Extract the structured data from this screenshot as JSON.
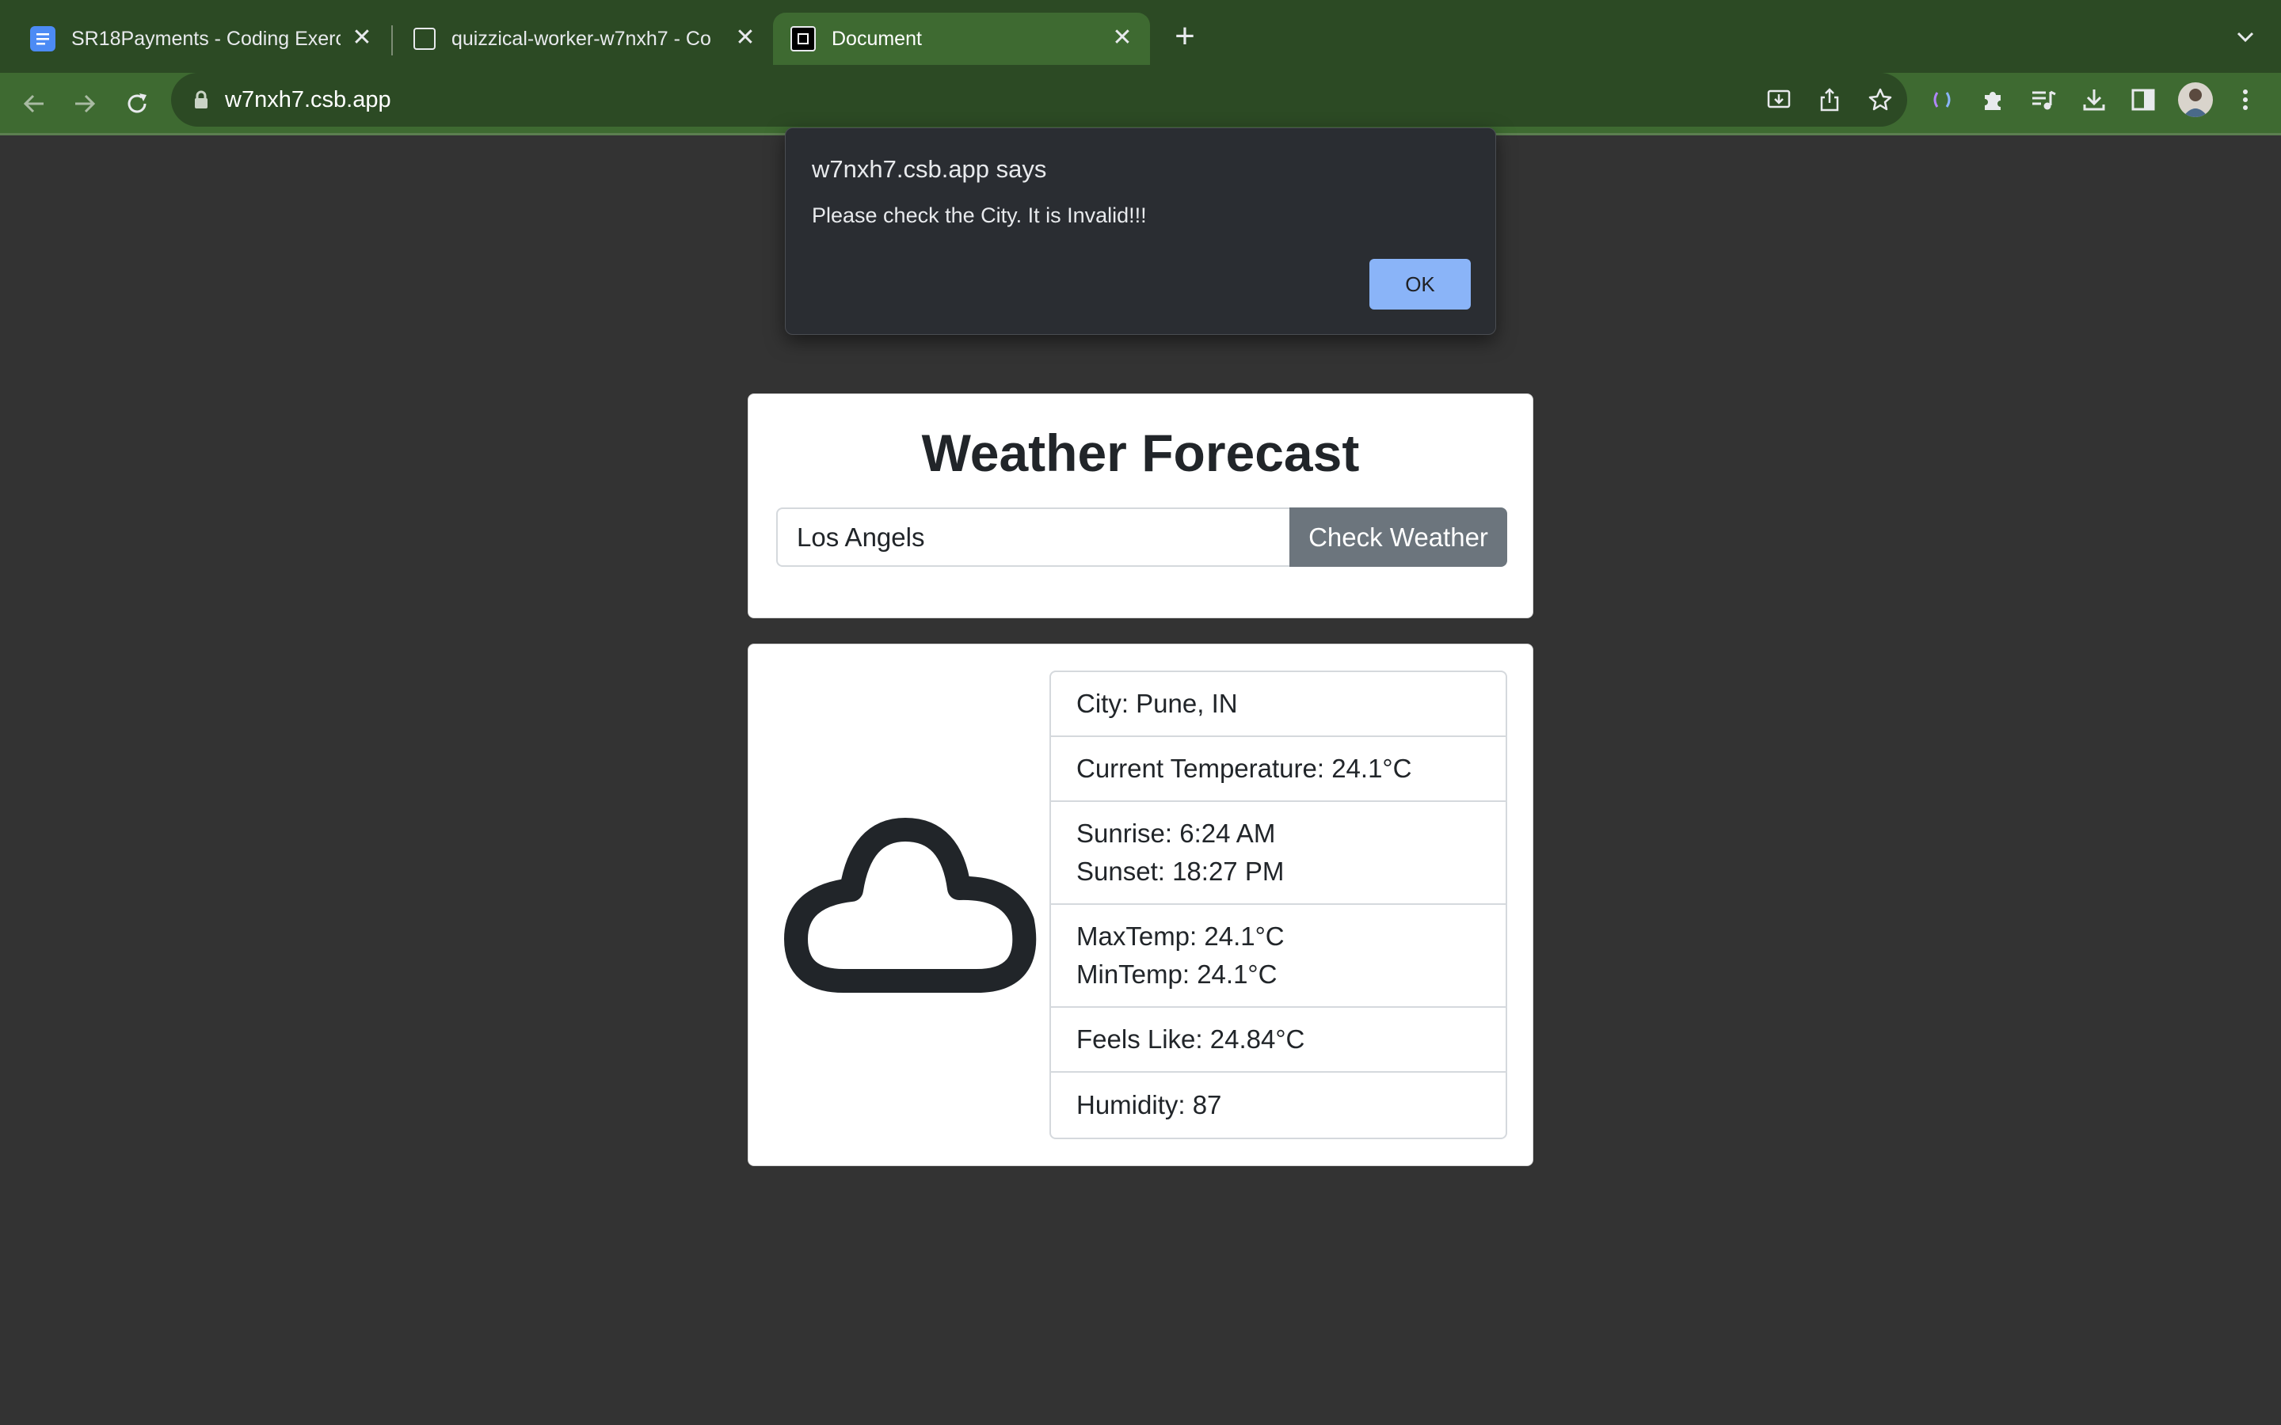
{
  "browser": {
    "tabs": [
      {
        "title": "SR18Payments - Coding Exerc"
      },
      {
        "title": "quizzical-worker-w7nxh7 - Co"
      },
      {
        "title": "Document"
      }
    ],
    "new_tab_label": "+",
    "url": "w7nxh7.csb.app"
  },
  "dialog": {
    "title": "w7nxh7.csb.app says",
    "message": "Please check the City. It is Invalid!!!",
    "ok_label": "OK"
  },
  "search": {
    "heading": "Weather Forecast",
    "city_value": "Los Angels",
    "button_label": "Check Weather"
  },
  "weather": {
    "icon": "cloud-icon",
    "city": "City: Pune, IN",
    "current_temperature": "Current Temperature: 24.1°C",
    "sunrise": "Sunrise: 6:24 AM",
    "sunset": "Sunset: 18:27 PM",
    "max_temp": "MaxTemp: 24.1°C",
    "min_temp": "MinTemp: 24.1°C",
    "feels_like": "Feels Like: 24.84°C",
    "humidity": "Humidity: 87"
  },
  "colors": {
    "page_background": "#333333",
    "tab_strip": "#2c4a24",
    "toolbar": "#3e6a31",
    "button_secondary": "#6c757d",
    "dialog_ok": "#8ab4f8"
  }
}
